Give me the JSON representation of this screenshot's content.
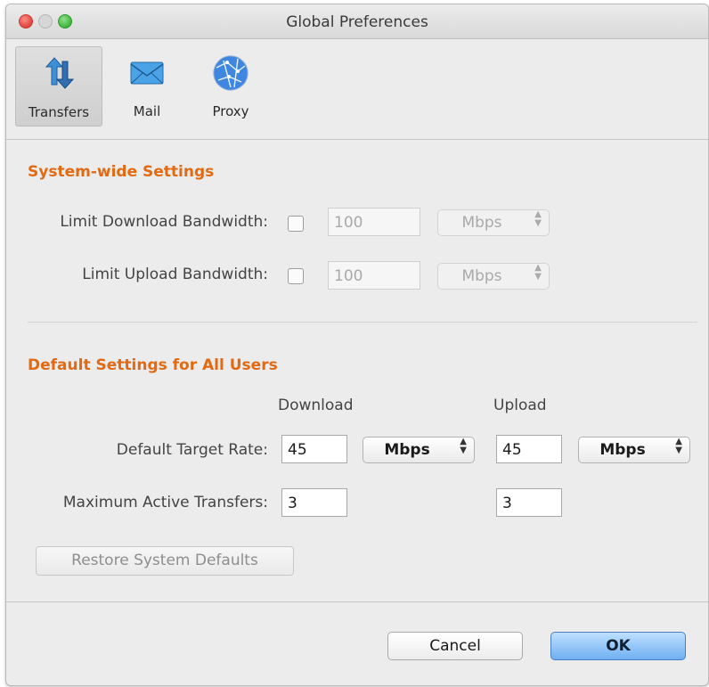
{
  "window": {
    "title": "Global Preferences"
  },
  "toolbar": {
    "items": [
      {
        "label": "Transfers",
        "icon": "transfers-icon",
        "selected": true
      },
      {
        "label": "Mail",
        "icon": "mail-icon",
        "selected": false
      },
      {
        "label": "Proxy",
        "icon": "proxy-globe-icon",
        "selected": false
      }
    ]
  },
  "system_wide": {
    "title": "System-wide Settings",
    "download": {
      "label": "Limit Download Bandwidth:",
      "checked": false,
      "value": "100",
      "unit": "Mbps"
    },
    "upload": {
      "label": "Limit Upload Bandwidth:",
      "checked": false,
      "value": "100",
      "unit": "Mbps"
    }
  },
  "defaults": {
    "title": "Default Settings for All Users",
    "col_download": "Download",
    "col_upload": "Upload",
    "target_rate_label": "Default Target Rate:",
    "download_rate": "45",
    "download_unit": "Mbps",
    "upload_rate": "45",
    "upload_unit": "Mbps",
    "max_transfers_label": "Maximum Active Transfers:",
    "download_max": "3",
    "upload_max": "3"
  },
  "buttons": {
    "restore": "Restore System Defaults",
    "cancel": "Cancel",
    "ok": "OK"
  },
  "colors": {
    "section_title": "#e26a12",
    "ok_button": "#6fb0f2"
  }
}
